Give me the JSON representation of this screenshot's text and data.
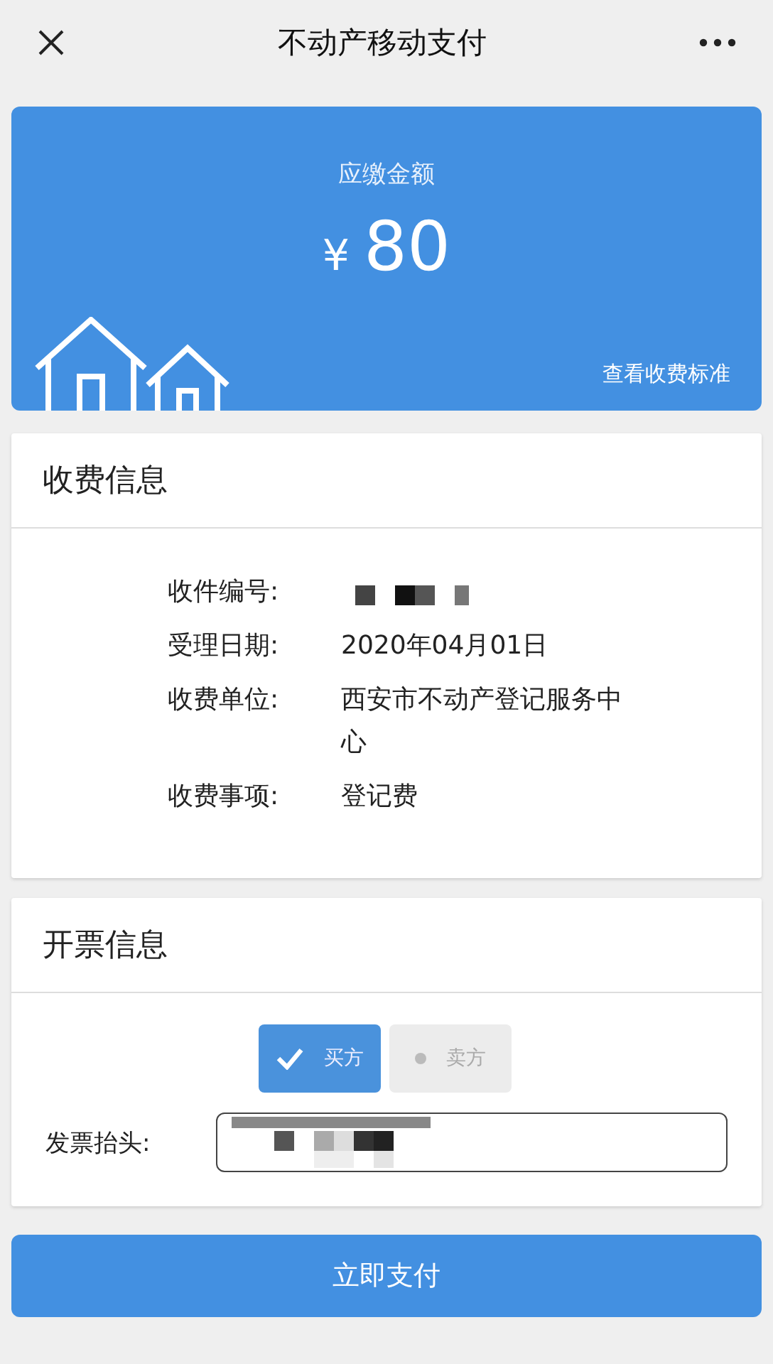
{
  "header": {
    "title": "不动产移动支付"
  },
  "amount_card": {
    "label": "应缴金额",
    "currency": "¥",
    "amount": "80",
    "link": "查看收费标准"
  },
  "fee_info": {
    "title": "收费信息",
    "rows": [
      {
        "label": "收件编号:",
        "value_masked": true
      },
      {
        "label": "受理日期:",
        "value": "2020年04月01日"
      },
      {
        "label": "收费单位:",
        "value": "西安市不动产登记服务中心"
      },
      {
        "label": "收费事项:",
        "value": "登记费"
      }
    ]
  },
  "invoice_info": {
    "title": "开票信息",
    "options": [
      {
        "label": "买方",
        "selected": true
      },
      {
        "label": "卖方",
        "selected": false
      }
    ],
    "field_label": "发票抬头:",
    "field_masked": true
  },
  "pay_button": {
    "label": "立即支付"
  }
}
